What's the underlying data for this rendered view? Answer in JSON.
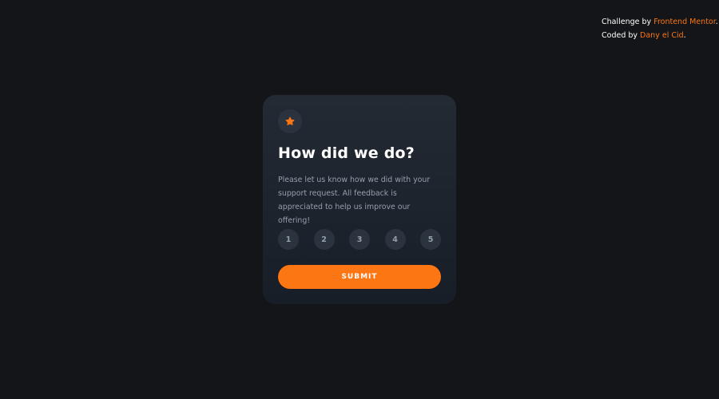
{
  "attribution": {
    "challenge_prefix": "Challenge by ",
    "challenge_link": "Frontend Mentor",
    "challenge_suffix": ".",
    "coded_prefix": "Coded by ",
    "coded_link": "Dany el Cid",
    "coded_suffix": "."
  },
  "card": {
    "icon": "star-icon",
    "title": "How did we do?",
    "description": "Please let us know how we did with your support request. All feedback is appreciated to help us improve our offering!",
    "ratings": [
      "1",
      "2",
      "3",
      "4",
      "5"
    ],
    "submit_label": "SUBMIT"
  },
  "colors": {
    "background": "#131518",
    "card": "#232a34",
    "accent": "#fc7614",
    "muted_text": "#969fad",
    "circle": "#2b333e"
  }
}
